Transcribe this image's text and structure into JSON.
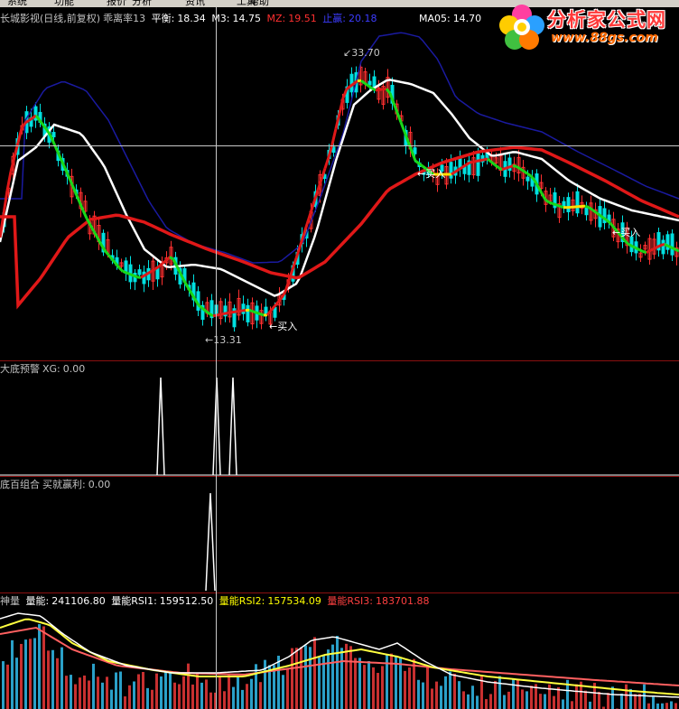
{
  "menu": [
    "系统",
    "功能",
    "报价",
    "分析",
    "资讯",
    "工具",
    "帮助"
  ],
  "main_panel": {
    "title": "长城影视(日线,前复权)",
    "indicator_name": "乖离率13",
    "pingheng_label": "平衡:",
    "pingheng_value": "18.34",
    "m3_label": "M3:",
    "m3_value": "14.75",
    "mz_label": "MZ:",
    "mz_value": "19.51",
    "zhiying_label": "止赢:",
    "zhiying_value": "20.18",
    "ma05_label": "MA05:",
    "ma05_value": "14.70",
    "high_label": "33.70",
    "low_label": "13.31",
    "buy_labels": [
      "买入",
      "买入",
      "买入"
    ]
  },
  "panel2": {
    "title": "大底预警",
    "xg_label": "XG:",
    "xg_value": "0.00"
  },
  "panel3": {
    "title": "底百组合",
    "label": "买就赢利:",
    "value": "0.00"
  },
  "panel4": {
    "title": "神量",
    "liangneng_label": "量能:",
    "liangneng_value": "241106.80",
    "rsi1_label": "量能RSI1:",
    "rsi1_value": "159512.50",
    "rsi2_label": "量能RSI2:",
    "rsi2_value": "157534.09",
    "rsi3_label": "量能RSI3:",
    "rsi3_value": "183701.88"
  },
  "logo": {
    "name": "分析家公式网",
    "url": "www.88gs.com"
  },
  "colors": {
    "red_line": "#e01818",
    "white_line": "#ffffff",
    "blue_line": "#1a1aa0",
    "green_line": "#18d818",
    "yellow_line": "#ffe000",
    "up": "#ff3030",
    "down": "#00e0e0",
    "panel_border": "#8a1010"
  }
}
